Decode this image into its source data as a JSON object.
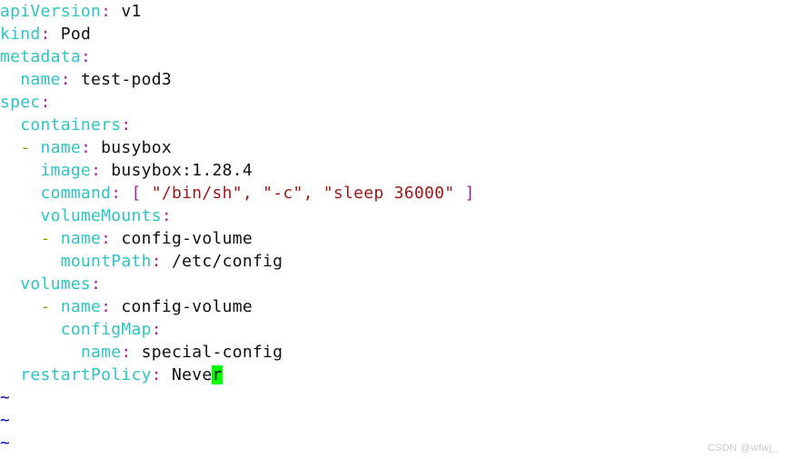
{
  "editor": {
    "app": "vim",
    "background_color": "#FFFFFF",
    "cursor_color": "#00FF00",
    "colors": {
      "key": "#2EC4C4",
      "punctuation": "#A020A0",
      "string": "#A01818",
      "dash": "#9A9A00",
      "value": "#101010",
      "tilde": "#0000C0"
    },
    "lines": [
      {
        "indent": "",
        "key": "apiVersion",
        "colon": ":",
        "value": " v1"
      },
      {
        "indent": "",
        "key": "kind",
        "colon": ":",
        "value": " Pod"
      },
      {
        "indent": "",
        "key": "metadata",
        "colon": ":",
        "value": ""
      },
      {
        "indent": "  ",
        "key": "name",
        "colon": ":",
        "value": " test-pod3"
      },
      {
        "indent": "",
        "key": "spec",
        "colon": ":",
        "value": ""
      },
      {
        "indent": "  ",
        "key": "containers",
        "colon": ":",
        "value": ""
      },
      {
        "indent": "  ",
        "dash": "- ",
        "key": "name",
        "colon": ":",
        "value": " busybox"
      },
      {
        "indent": "    ",
        "key": "image",
        "colon": ":",
        "value": " busybox:1.28.4"
      },
      {
        "indent": "    ",
        "key": "command",
        "colon": ":",
        "value": "",
        "command": true
      },
      {
        "indent": "    ",
        "key": "volumeMounts",
        "colon": ":",
        "value": ""
      },
      {
        "indent": "    ",
        "dash": "- ",
        "key": "name",
        "colon": ":",
        "value": " config-volume"
      },
      {
        "indent": "      ",
        "key": "mountPath",
        "colon": ":",
        "value": " /etc/config"
      },
      {
        "indent": "  ",
        "key": "volumes",
        "colon": ":",
        "value": ""
      },
      {
        "indent": "    ",
        "dash": "- ",
        "key": "name",
        "colon": ":",
        "value": " config-volume"
      },
      {
        "indent": "      ",
        "key": "configMap",
        "colon": ":",
        "value": ""
      },
      {
        "indent": "        ",
        "key": "name",
        "colon": ":",
        "value": " special-config"
      },
      {
        "indent": "  ",
        "key": "restartPolicy",
        "colon": ":",
        "value": " Neve",
        "cursor_char": "r"
      }
    ],
    "command_line": {
      "open_bracket": "[",
      "close_bracket": "]",
      "items": [
        "\"/bin/sh\"",
        "\"-c\"",
        "\"sleep 36000\""
      ],
      "separator": ", ",
      "pad": " "
    },
    "empty_markers": [
      "~",
      "~",
      "~"
    ]
  },
  "watermark": {
    "text": "CSDN @wfwj_"
  }
}
